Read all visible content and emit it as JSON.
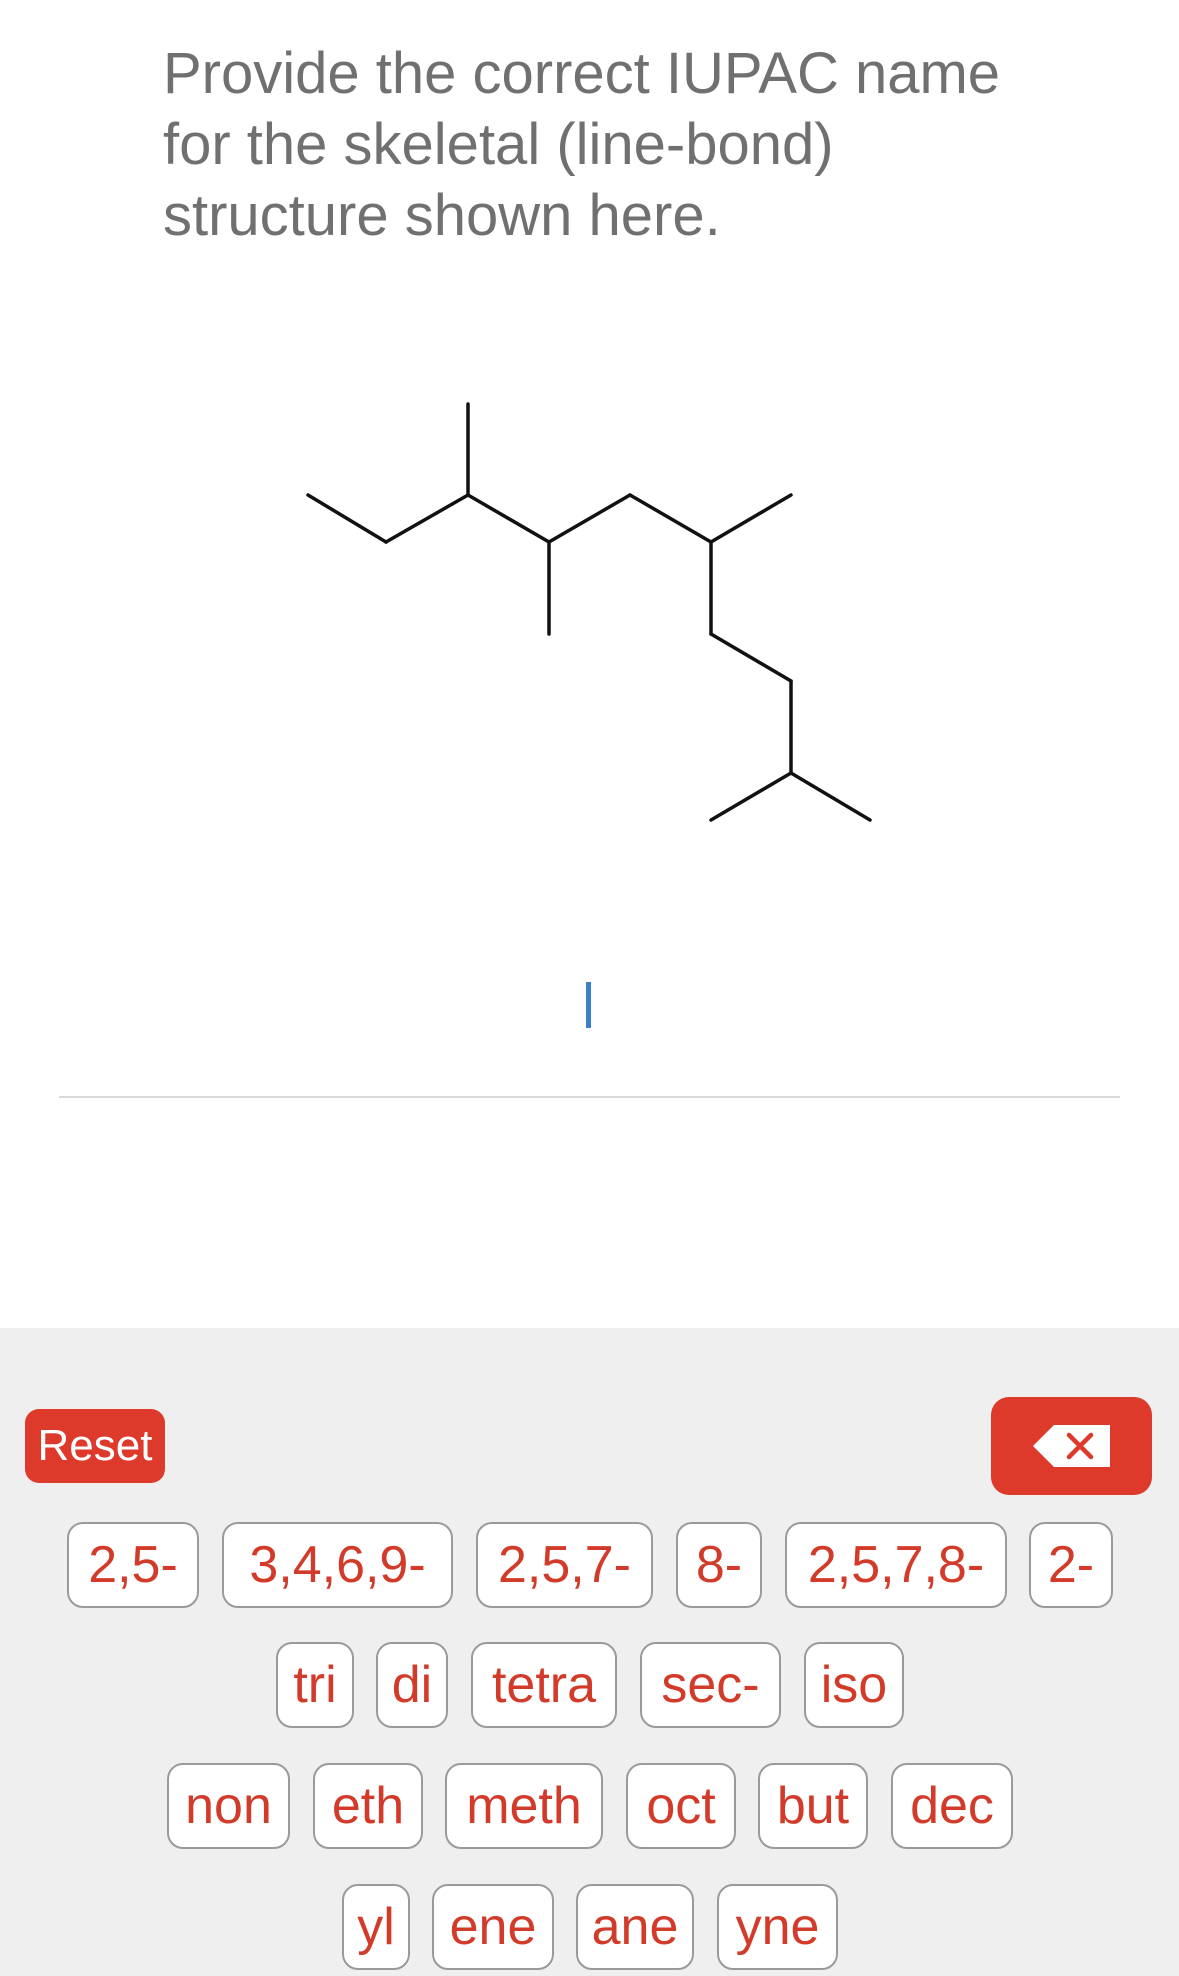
{
  "question": {
    "line1": "Provide the correct IUPAC name",
    "line2": "for the skeletal (line-bond)",
    "line3": "structure shown here."
  },
  "answer": {
    "value": ""
  },
  "controls": {
    "reset_label": "Reset",
    "backspace_icon": "backspace-icon"
  },
  "colors": {
    "accent": "#dd3a2b",
    "key_text": "#d23b2a",
    "cursor": "#3b7fc4",
    "keyboard_bg": "#efefef"
  },
  "keys": {
    "row1": [
      "2,5-",
      "3,4,6,9-",
      "2,5,7-",
      "8-",
      "2,5,7,8-",
      "2-"
    ],
    "row2": [
      "tri",
      "di",
      "tetra",
      "sec-",
      "iso"
    ],
    "row3": [
      "non",
      "eth",
      "meth",
      "oct",
      "but",
      "dec"
    ],
    "row4": [
      "yl",
      "ene",
      "ane",
      "yne"
    ]
  }
}
